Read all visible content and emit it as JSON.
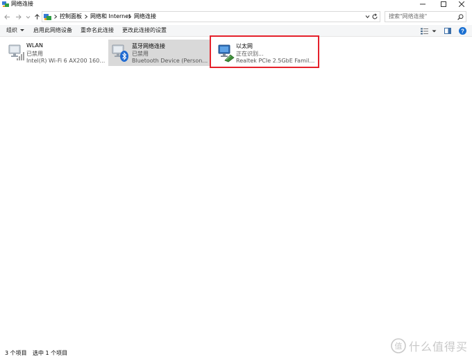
{
  "window": {
    "title": "网络连接"
  },
  "address": {
    "crumbs": [
      "控制面板",
      "网络和 Internet",
      "网络连接"
    ]
  },
  "search": {
    "placeholder": "搜索\"网络连接\""
  },
  "commands": {
    "organize": "组织",
    "enable_device": "启用此网络设备",
    "rename": "重命名此连接",
    "change_settings": "更改此连接的设置"
  },
  "connections": [
    {
      "name": "WLAN",
      "status": "已禁用",
      "device": "Intel(R) Wi-Fi 6 AX200 160MHz"
    },
    {
      "name": "蓝牙网络连接",
      "status": "已禁用",
      "device": "Bluetooth Device (Personal Ar..."
    },
    {
      "name": "以太网",
      "status": "正在识别...",
      "device": "Realtek PCIe 2.5GbE Family Co..."
    }
  ],
  "statusbar": {
    "count": "3 个项目",
    "selected": "选中 1 个项目"
  },
  "watermark": {
    "text": "什么值得买"
  },
  "colors": {
    "highlight": "#e5202a",
    "selected_bg": "#d9d9d9",
    "help_blue": "#1a6fd1"
  }
}
